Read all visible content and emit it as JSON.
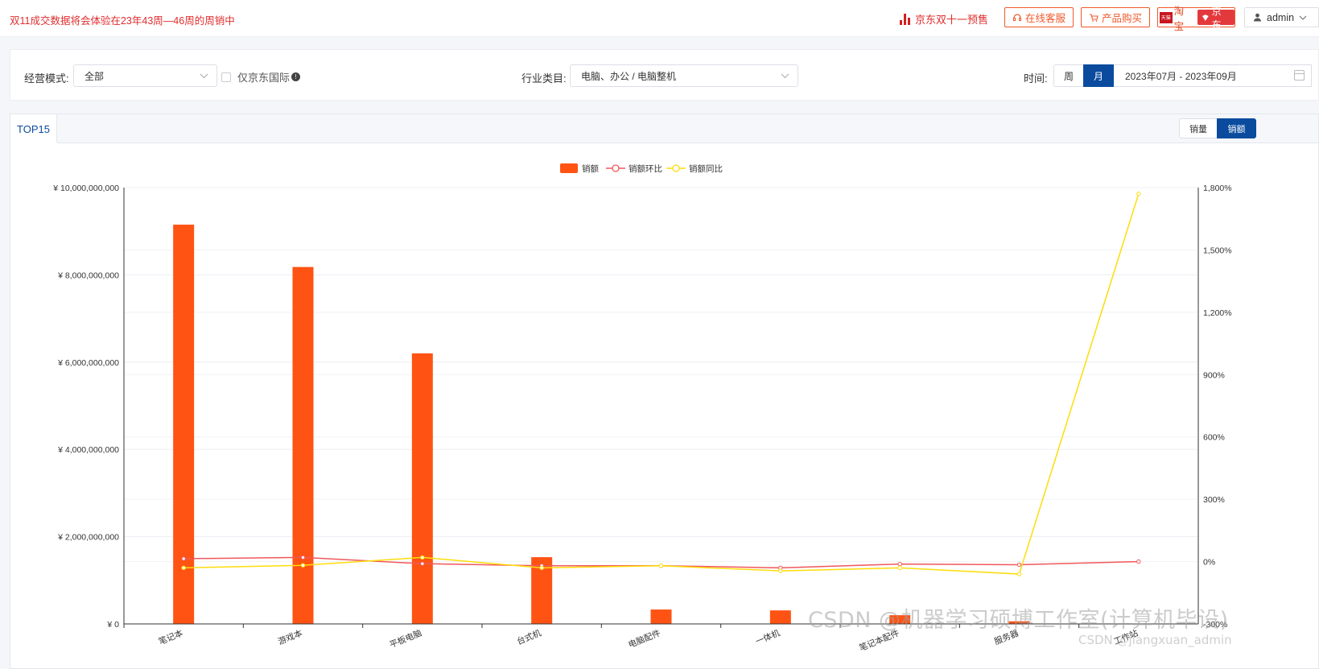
{
  "topbar": {
    "notice": "双11成交数据将会体验在23年43周—46周的周销中",
    "presale": "京东双十一预售",
    "service_btn": "在线客服",
    "buy_btn": "产品购买",
    "tmall_text": "天猫",
    "taobao": "淘宝",
    "jd": "京东",
    "user": "admin"
  },
  "filters": {
    "mode_label": "经营模式:",
    "mode_value": "全部",
    "jd_intl_label": "仅京东国际",
    "industry_label": "行业类目:",
    "industry_value": "电脑、办公 / 电脑整机",
    "time_label": "时间:",
    "week_btn": "周",
    "month_btn": "月",
    "date_range": "2023年07月 - 2023年09月"
  },
  "panel": {
    "tab": "TOP15",
    "metric_volume": "销量",
    "metric_amount": "销额"
  },
  "watermark": "CSDN @机器学习硕博工作室(计算机毕设)",
  "watermark2": "CSDN @jiangxuan_admin",
  "colors": {
    "bar": "#ff5314",
    "mom": "#f0585c",
    "yoy": "#fddd0b",
    "brand": "#0a4b9e"
  },
  "chart_data": {
    "type": "bar",
    "legend": [
      "销额",
      "销额环比",
      "销额同比"
    ],
    "categories": [
      "笔记本",
      "游戏本",
      "平板电脑",
      "台式机",
      "电脑配件",
      "一体机",
      "笔记本配件",
      "服务器",
      "工作站"
    ],
    "y_left": {
      "min": 0,
      "max": 10000000000,
      "ticks": [
        "¥ 0",
        "¥ 2,000,000,000",
        "¥ 4,000,000,000",
        "¥ 6,000,000,000",
        "¥ 8,000,000,000",
        "¥ 10,000,000,000"
      ]
    },
    "y_right": {
      "min": -300,
      "max": 1800,
      "ticks": [
        "-300%",
        "0%",
        "300%",
        "600%",
        "900%",
        "1,200%",
        "1,500%",
        "1,800%"
      ]
    },
    "series": [
      {
        "name": "销额",
        "type": "bar",
        "values": [
          9150000000,
          8180000000,
          6200000000,
          1530000000,
          330000000,
          310000000,
          200000000,
          60000000,
          0
        ]
      },
      {
        "name": "销额环比",
        "type": "line",
        "axis": "right",
        "values": [
          14,
          20,
          -10,
          -20,
          -20,
          -30,
          -12,
          -15,
          0
        ]
      },
      {
        "name": "销额同比",
        "type": "line",
        "axis": "right",
        "values": [
          -30,
          -18,
          20,
          -30,
          -20,
          -45,
          -30,
          -60,
          1770
        ]
      }
    ]
  }
}
